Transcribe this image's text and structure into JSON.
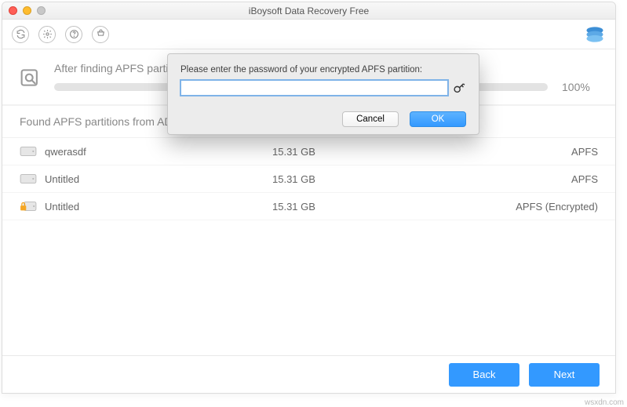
{
  "window": {
    "title": "iBoysoft Data Recovery Free"
  },
  "scan": {
    "status_text": "After finding APFS partitions",
    "percent": "100%"
  },
  "section": {
    "heading": "Found APFS partitions from AD"
  },
  "partitions": [
    {
      "name": "qwerasdf",
      "size": "15.31 GB",
      "fs": "APFS",
      "locked": false
    },
    {
      "name": "Untitled",
      "size": "15.31 GB",
      "fs": "APFS",
      "locked": false
    },
    {
      "name": "Untitled",
      "size": "15.31 GB",
      "fs": "APFS (Encrypted)",
      "locked": true
    }
  ],
  "modal": {
    "message": "Please enter the password of your encrypted APFS partition:",
    "cancel": "Cancel",
    "ok": "OK"
  },
  "footer": {
    "back": "Back",
    "next": "Next"
  },
  "watermark": "wsxdn.com"
}
